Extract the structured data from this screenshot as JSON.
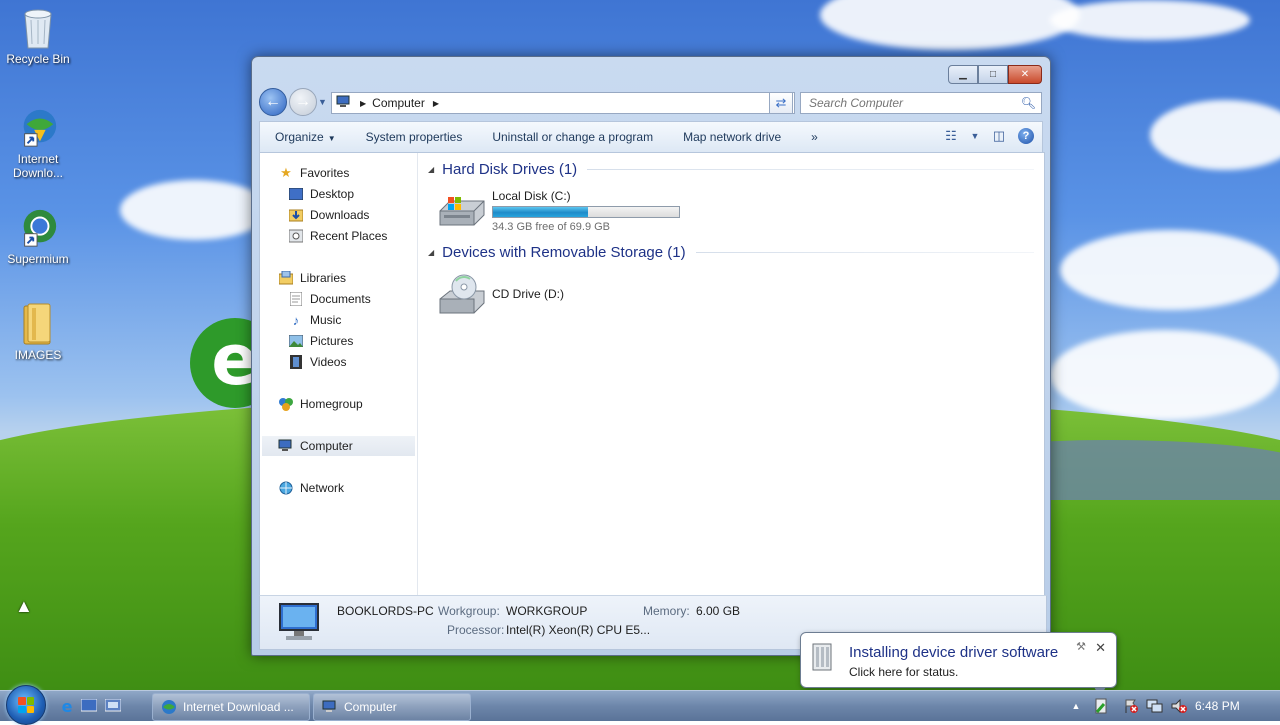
{
  "desktop": {
    "icons": [
      {
        "label": "Recycle Bin"
      },
      {
        "label": "Internet Downlo..."
      },
      {
        "label": "Supermium"
      },
      {
        "label": "IMAGES"
      }
    ]
  },
  "window": {
    "address": {
      "segment": "Computer"
    },
    "search": {
      "placeholder": "Search Computer"
    },
    "commands": {
      "organize": "Organize",
      "system_properties": "System properties",
      "uninstall": "Uninstall or change a program",
      "map_drive": "Map network drive",
      "more": "»"
    },
    "nav": {
      "favorites": "Favorites",
      "desktop": "Desktop",
      "downloads": "Downloads",
      "recent": "Recent Places",
      "libraries": "Libraries",
      "documents": "Documents",
      "music": "Music",
      "pictures": "Pictures",
      "videos": "Videos",
      "homegroup": "Homegroup",
      "computer": "Computer",
      "network": "Network"
    },
    "groups": {
      "hdd_title": "Hard Disk Drives (1)",
      "removable_title": "Devices with Removable Storage (1)"
    },
    "drives": {
      "local": {
        "name": "Local Disk (C:)",
        "free_text": "34.3 GB free of 69.9 GB",
        "used_fraction": 0.51
      },
      "cd": {
        "name": "CD Drive (D:)"
      }
    },
    "details": {
      "pc_name": "BOOKLORDS-PC",
      "workgroup_label": "Workgroup:",
      "workgroup": "WORKGROUP",
      "memory_label": "Memory:",
      "memory": "6.00 GB",
      "processor_label": "Processor:",
      "processor": "Intel(R) Xeon(R) CPU E5..."
    }
  },
  "balloon": {
    "title": "Installing device driver software",
    "subtitle": "Click here for status."
  },
  "taskbar": {
    "buttons": [
      {
        "label": "Internet Download ..."
      },
      {
        "label": "Computer"
      }
    ],
    "clock": "6:48 PM"
  }
}
